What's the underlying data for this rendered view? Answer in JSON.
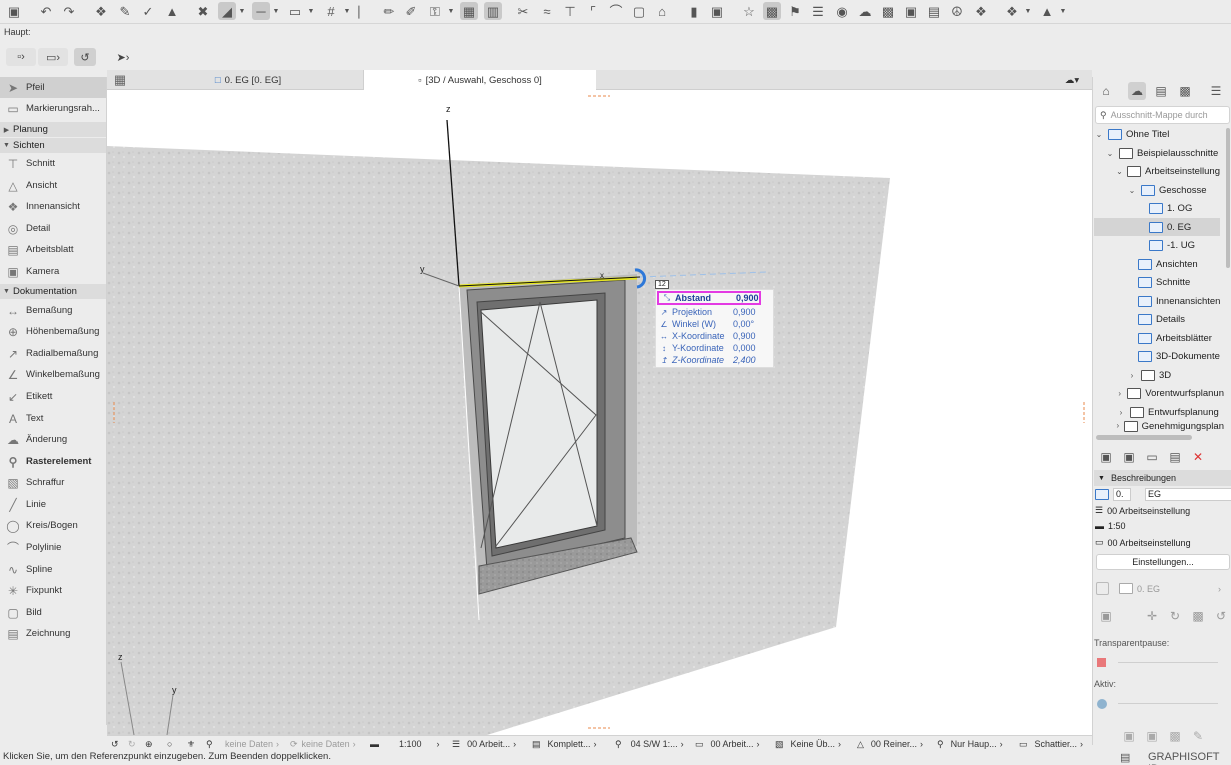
{
  "toolbar": {
    "icons": [
      "save-icon",
      "undo-icon",
      "redo-icon",
      "pick-up-parameters-icon",
      "inject-parameters-icon",
      "eyedropper-icon",
      "magic-wand-icon",
      "cursor-snap-icon",
      "guide-lines-icon",
      "snap-guides-icon",
      "grid-icon",
      "measure-icon",
      "pen-icon",
      "lock-icon",
      "dimension-icon",
      "element-info-icon",
      "trim-icon",
      "split-icon",
      "adjust-icon",
      "intersect-icon",
      "fillet-icon",
      "offset-icon",
      "resize-icon",
      "roof-icon",
      "align-icon",
      "distribute-icon",
      "favorites-icon",
      "renovation-icon",
      "flag-icon",
      "layers-icon",
      "3d-icon",
      "selection-icon",
      "model-icon",
      "text-icon",
      "teamwork-icon",
      "tag-icon",
      "navigate-icon",
      "drawing-mode-icon"
    ]
  },
  "haupt_label": "Haupt:",
  "palette": {
    "items": [
      {
        "label": "Pfeil",
        "icon": "arrow-icon",
        "selected": true
      },
      {
        "label": "Markierungsrah...",
        "icon": "marquee-icon"
      }
    ],
    "sections": [
      {
        "label": "Planung",
        "expanded": false
      },
      {
        "label": "Sichten",
        "expanded": true,
        "items": [
          "Schnitt",
          "Ansicht",
          "Innenansicht",
          "Detail",
          "Arbeitsblatt",
          "Kamera"
        ]
      },
      {
        "label": "Dokumentation",
        "expanded": true,
        "items": [
          "Bemaßung",
          "Höhenbemaßung",
          "Radialbemaßung",
          "Winkelbemaßung",
          "Etikett",
          "Text",
          "Änderung",
          "Rasterelement",
          "Schraffur",
          "Linie",
          "Kreis/Bogen",
          "Polylinie",
          "Spline",
          "Fixpunkt",
          "Bild",
          "Zeichnung"
        ]
      }
    ]
  },
  "tabs": [
    {
      "label": "0. EG [0. EG]",
      "active": false
    },
    {
      "label": "[3D / Auswahl, Geschoss 0]",
      "active": true
    }
  ],
  "viewport": {
    "axis_labels": {
      "z": "z",
      "y": "y",
      "x": "x"
    },
    "corner_axis": {
      "z": "z",
      "y": "y"
    },
    "tracker": [
      {
        "label": "Abstand",
        "value": "0,900",
        "icon": "distance-icon",
        "highlight": true
      },
      {
        "label": "Projektion",
        "value": "0,900",
        "icon": "projection-icon"
      },
      {
        "label": "Winkel (W)",
        "value": "0,00°",
        "icon": "angle-icon"
      },
      {
        "label": "X-Koordinate",
        "value": "0,900",
        "icon": "x-coordinate-icon"
      },
      {
        "label": "Y-Koordinate",
        "value": "0,000",
        "icon": "y-coordinate-icon"
      },
      {
        "label": "Z-Koordinate",
        "value": "2,400",
        "icon": "z-coordinate-icon"
      }
    ],
    "tracker_badge": "12"
  },
  "navigator": {
    "search_placeholder": "Ausschnitt-Mappe durch",
    "tree": [
      {
        "label": "Ohne Titel",
        "level": 0,
        "expanded": true
      },
      {
        "label": "Beispielausschnitte",
        "level": 1,
        "expanded": true
      },
      {
        "label": "Arbeitseinstellung",
        "level": 2,
        "expanded": true
      },
      {
        "label": "Geschosse",
        "level": 3,
        "expanded": true
      },
      {
        "label": "1. OG",
        "level": 4
      },
      {
        "label": "0. EG",
        "level": 4,
        "selected": true
      },
      {
        "label": "-1. UG",
        "level": 4
      },
      {
        "label": "Ansichten",
        "level": 3
      },
      {
        "label": "Schnitte",
        "level": 3
      },
      {
        "label": "Innenansichten",
        "level": 3
      },
      {
        "label": "Details",
        "level": 3
      },
      {
        "label": "Arbeitsblätter",
        "level": 3
      },
      {
        "label": "3D-Dokumente",
        "level": 3
      },
      {
        "label": "3D",
        "level": 3,
        "collapsed": true
      },
      {
        "label": "Vorentwurfsplanun",
        "level": 2,
        "collapsed": true
      },
      {
        "label": "Entwurfsplanung",
        "level": 2,
        "collapsed": true
      },
      {
        "label": "Genehmigungsplan",
        "level": 2,
        "collapsed": true
      }
    ],
    "beschreibungen_label": "Beschreibungen",
    "name_prefix": "0.",
    "name_value": "EG",
    "layer_combo": "00 Arbeitseinstellung",
    "scale": "1:50",
    "view_combo": "00 Arbeitseinstellung",
    "settings_button": "Einstellungen...",
    "story_select": "0. EG",
    "transparent_label": "Transparentpause:",
    "active_label": "Aktiv:"
  },
  "statusbar": {
    "items": [
      {
        "label": "keine Daten",
        "dim": true
      },
      {
        "label": "keine Daten",
        "dim": true
      },
      {
        "label": "1:100"
      },
      {
        "label": "00 Arbeit..."
      },
      {
        "label": "Komplett..."
      },
      {
        "label": "04 S/W 1:..."
      },
      {
        "label": "00 Arbeit..."
      },
      {
        "label": "Keine Üb..."
      },
      {
        "label": "00 Reiner..."
      },
      {
        "label": "Nur Haup..."
      },
      {
        "label": "Schattier..."
      }
    ]
  },
  "hint": "Klicken Sie, um den Referenzpunkt einzugeben. Zum Beenden doppelklicken.",
  "brand": "GRAPHISOFT ID"
}
